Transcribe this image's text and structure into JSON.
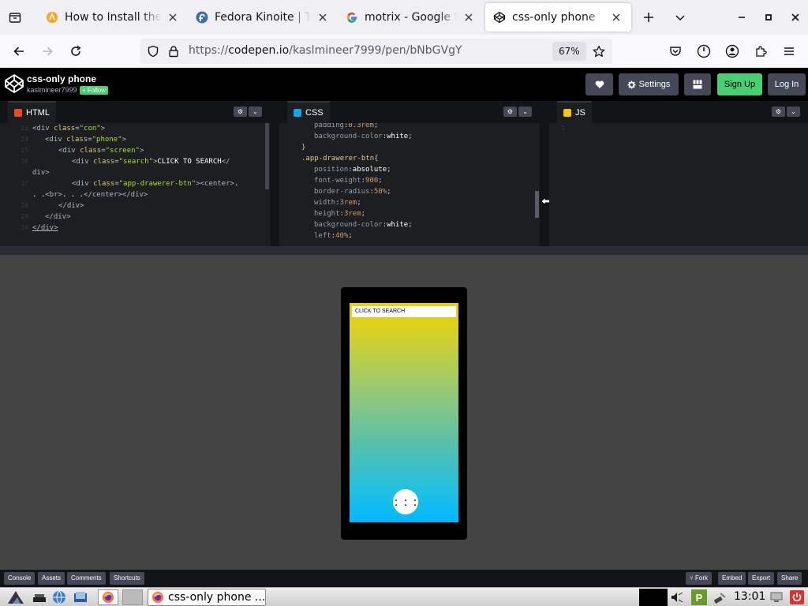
{
  "browser": {
    "tabs": [
      {
        "title": "How to Install the L",
        "favicon": "site-icon",
        "active": false
      },
      {
        "title": "Fedora Kinoite | The",
        "favicon": "fedora-icon",
        "active": false
      },
      {
        "title": "motrix - Google Sea",
        "favicon": "google-icon",
        "active": false
      },
      {
        "title": "css-only phone",
        "favicon": "codepen-icon",
        "active": true
      }
    ],
    "url_prefix": "https://",
    "url_host": "codepen.io",
    "url_path": "/kaslmineer7999/pen/bNbGVgY",
    "zoom": "67%"
  },
  "codepen": {
    "title": "css-only phone",
    "author": "kaslmineer7999",
    "follow_label": "+ Follow",
    "settings_label": "Settings",
    "signup_label": "Sign Up",
    "login_label": "Log In",
    "editors": {
      "html_label": "HTML",
      "css_label": "CSS",
      "js_label": "JS"
    },
    "footer": {
      "console": "Console",
      "assets": "Assets",
      "comments": "Comments",
      "shortcuts": "Shortcuts",
      "fork": "Fork",
      "embed": "Embed",
      "export": "Export",
      "share": "Share"
    }
  },
  "preview": {
    "search_text": "CLICK TO SEARCH",
    "drawer_dots": ". . .\n. . ."
  },
  "taskbar": {
    "task_title": "css-only phone ...",
    "clock": "13:01"
  },
  "colors": {
    "html_badge": "#e44d26",
    "css_badge": "#1da1f2",
    "js_badge": "#f7c600",
    "signup_green": "#47cf73"
  }
}
